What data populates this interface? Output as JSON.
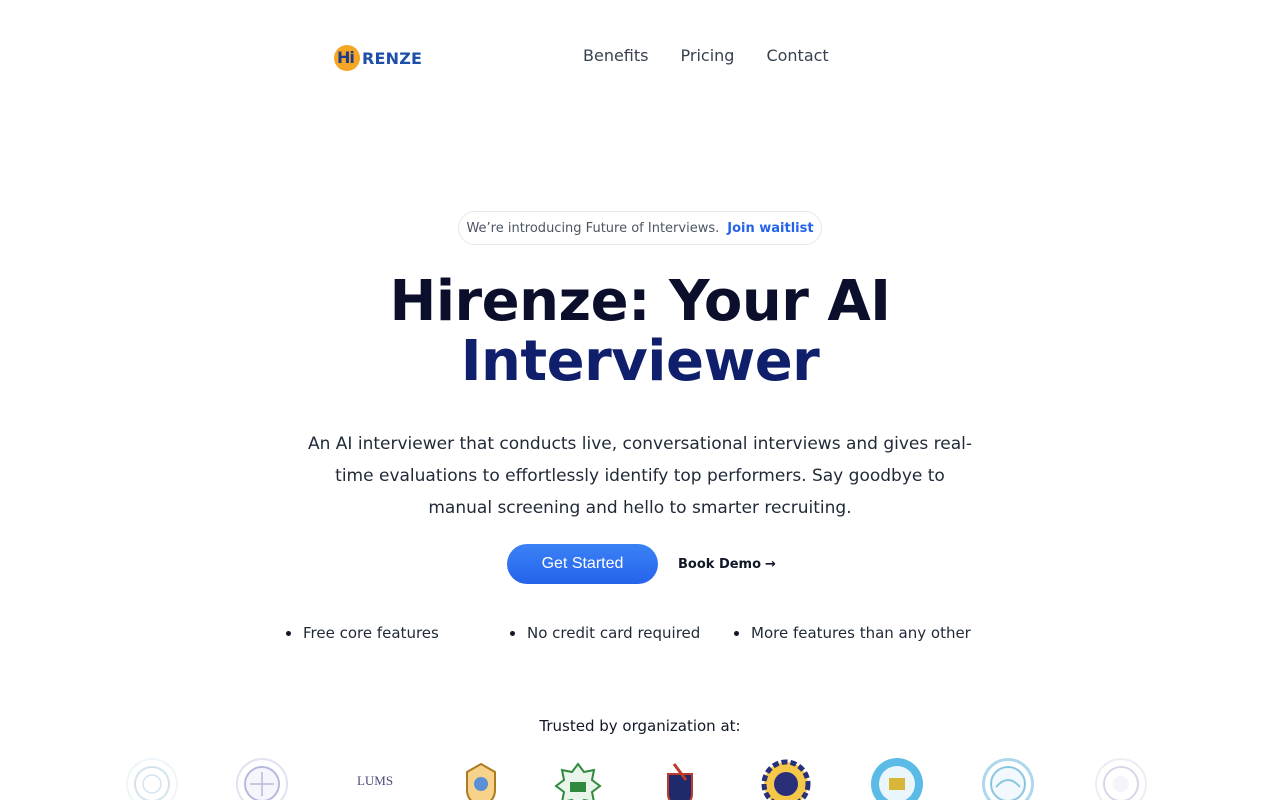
{
  "brand": {
    "logo_text": "RENZE",
    "logo_badge": "Hi"
  },
  "nav": {
    "items": [
      "Benefits",
      "Pricing",
      "Contact"
    ]
  },
  "announcement": {
    "text": "We’re introducing Future of Interviews.",
    "link": "Join waitlist"
  },
  "hero": {
    "title_line1": "Hirenze: Your AI",
    "title_line2": "Interviewer",
    "subtitle": "An AI interviewer that conducts live, conversational interviews and gives real-time evaluations to effortlessly identify top performers. Say goodbye to manual screening and hello to smarter recruiting."
  },
  "cta": {
    "primary": "Get Started",
    "secondary": "Book Demo",
    "secondary_arrow": "→"
  },
  "features": [
    "Free core features",
    "No credit card required",
    "More features than any other"
  ],
  "trusted": {
    "heading": "Trusted by organization at:",
    "lums_label": "LUMS"
  },
  "colors": {
    "accent": "#2563eb",
    "title_dark": "#0b0f2b",
    "title_blue": "#0f1f6b",
    "logo_orange": "#f5a623"
  }
}
